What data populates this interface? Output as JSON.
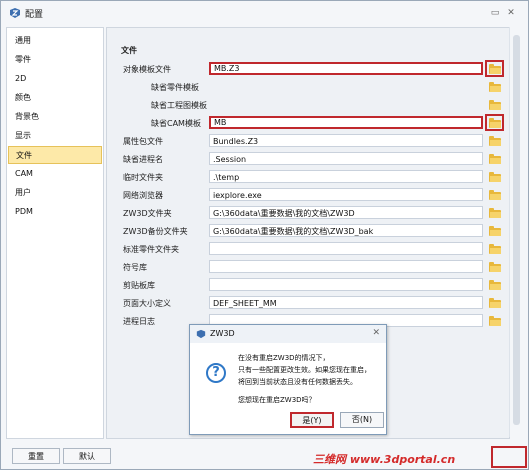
{
  "window": {
    "title": "配置",
    "icon": "zw3d-app-icon"
  },
  "sidebar": {
    "items": [
      {
        "label": "通用"
      },
      {
        "label": "零件"
      },
      {
        "label": "2D"
      },
      {
        "label": "颜色"
      },
      {
        "label": "背景色"
      },
      {
        "label": "显示"
      },
      {
        "label": "文件",
        "selected": true
      },
      {
        "label": "CAM"
      },
      {
        "label": "用户"
      },
      {
        "label": "PDM"
      }
    ]
  },
  "panel": {
    "section": "文件",
    "rows": [
      {
        "label": "对象模板文件",
        "value": "MB.Z3",
        "has_field": true
      },
      {
        "label": "缺省零件模板",
        "value": "",
        "has_field": false
      },
      {
        "label": "缺省工程图模板",
        "value": "",
        "has_field": false
      },
      {
        "label": "缺省CAM模板",
        "value": "MB",
        "has_field": true
      },
      {
        "label": "属性包文件",
        "value": "Bundles.Z3",
        "has_field": true
      },
      {
        "label": "缺省进程名",
        "value": ".Session",
        "has_field": true
      },
      {
        "label": "临时文件夹",
        "value": ".\\temp",
        "has_field": true
      },
      {
        "label": "网络浏览器",
        "value": "iexplore.exe",
        "has_field": true
      },
      {
        "label": "ZW3D文件夹",
        "value": "G:\\360data\\重要数据\\我的文档\\ZW3D",
        "has_field": true
      },
      {
        "label": "ZW3D备份文件夹",
        "value": "G:\\360data\\重要数据\\我的文档\\ZW3D_bak",
        "has_field": true
      },
      {
        "label": "标准零件文件夹",
        "value": "",
        "has_field": true
      },
      {
        "label": "符号库",
        "value": "",
        "has_field": true
      },
      {
        "label": "剪贴板库",
        "value": "",
        "has_field": true
      },
      {
        "label": "页面大小定义",
        "value": "DEF_SHEET_MM",
        "has_field": true
      },
      {
        "label": "进程日志",
        "value": "",
        "has_field": true
      }
    ]
  },
  "bottom": {
    "reset_label": "重置",
    "default_label": "默认"
  },
  "dialog": {
    "title": "ZW3D",
    "icon": "question-icon",
    "lines": [
      "在没有重启ZW3D的情况下，",
      "只有一些配置更改生效。如果您现在重启，",
      "将回到当前状态且没有任何数据丢失。"
    ],
    "question": "您想现在重启ZW3D吗？",
    "yes_label": "是(Y)",
    "no_label": "否(N)"
  },
  "watermark": "三维网 www.3dportal.cn",
  "colors": {
    "highlight": "#c0282d",
    "selection": "#fde9a8",
    "folder": "#e8b83c",
    "question": "#2f78c7"
  }
}
